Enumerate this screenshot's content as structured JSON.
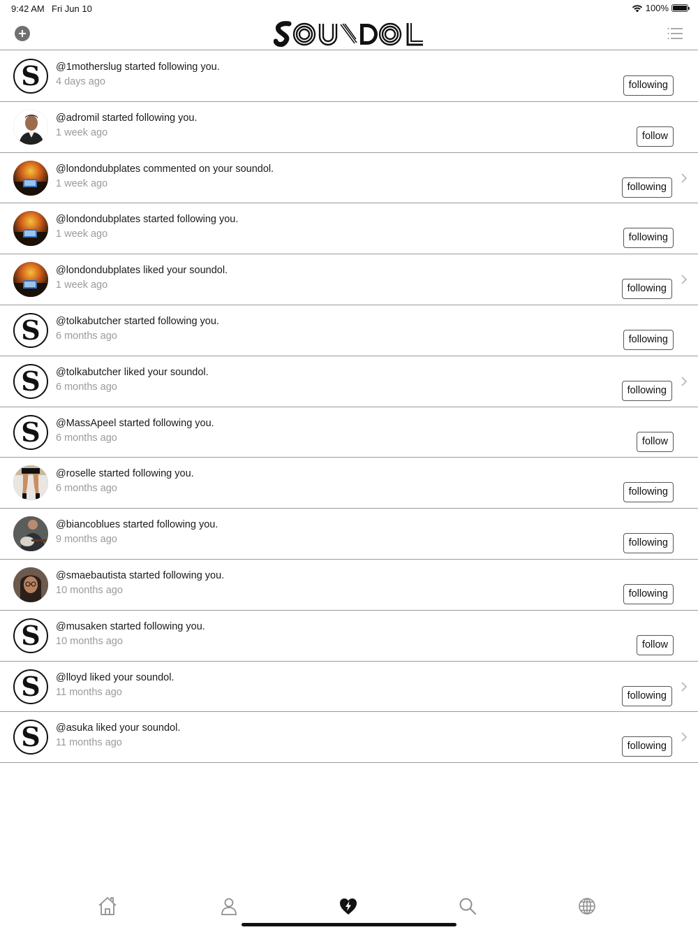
{
  "status_bar": {
    "time": "9:42 AM",
    "date": "Fri Jun 10",
    "battery": "100%"
  },
  "header": {
    "logo_text": "SOUNDOL",
    "add_icon": "plus-circle-icon",
    "menu_icon": "list-menu-icon"
  },
  "notifications": [
    {
      "text": "@1motherslug started following you.",
      "time": "4 days ago",
      "button": "following",
      "avatar": "soundol-logo",
      "chevron": false
    },
    {
      "text": "@adromil started following you.",
      "time": "1 week ago",
      "button": "follow",
      "avatar": "photo-man",
      "chevron": false
    },
    {
      "text": "@londondubplates commented on your soundol.",
      "time": "1 week ago",
      "button": "following",
      "avatar": "photo-sunset",
      "chevron": true
    },
    {
      "text": "@londondubplates started following you.",
      "time": "1 week ago",
      "button": "following",
      "avatar": "photo-sunset",
      "chevron": false
    },
    {
      "text": "@londondubplates liked your soundol.",
      "time": "1 week ago",
      "button": "following",
      "avatar": "photo-sunset",
      "chevron": true
    },
    {
      "text": "@tolkabutcher started following you.",
      "time": "6 months ago",
      "button": "following",
      "avatar": "soundol-logo",
      "chevron": false
    },
    {
      "text": "@tolkabutcher liked your soundol.",
      "time": "6 months ago",
      "button": "following",
      "avatar": "soundol-logo",
      "chevron": true
    },
    {
      "text": "@MassApeel started following you.",
      "time": "6 months ago",
      "button": "follow",
      "avatar": "soundol-logo",
      "chevron": false
    },
    {
      "text": "@roselle started following you.",
      "time": "6 months ago",
      "button": "following",
      "avatar": "photo-legs",
      "chevron": false
    },
    {
      "text": "@biancoblues started following you.",
      "time": "9 months ago",
      "button": "following",
      "avatar": "photo-guitar",
      "chevron": false
    },
    {
      "text": "@smaebautista started following you.",
      "time": "10 months ago",
      "button": "following",
      "avatar": "photo-woman",
      "chevron": false
    },
    {
      "text": "@musaken started following you.",
      "time": "10 months ago",
      "button": "follow",
      "avatar": "soundol-logo",
      "chevron": false
    },
    {
      "text": "@lloyd liked your soundol.",
      "time": "11 months ago",
      "button": "following",
      "avatar": "soundol-logo",
      "chevron": true
    },
    {
      "text": "@asuka liked your soundol.",
      "time": "11 months ago",
      "button": "following",
      "avatar": "soundol-logo",
      "chevron": true
    }
  ],
  "tab_bar": [
    {
      "icon": "home-icon",
      "active": false
    },
    {
      "icon": "profile-icon",
      "active": false
    },
    {
      "icon": "heart-bolt-icon",
      "active": true
    },
    {
      "icon": "search-icon",
      "active": false
    },
    {
      "icon": "globe-icon",
      "active": false
    }
  ],
  "colors": {
    "divider": "#9a9a9a",
    "secondary_text": "#9a9a9a",
    "icon_gray": "#8e8e8e",
    "active_icon": "#111111"
  }
}
